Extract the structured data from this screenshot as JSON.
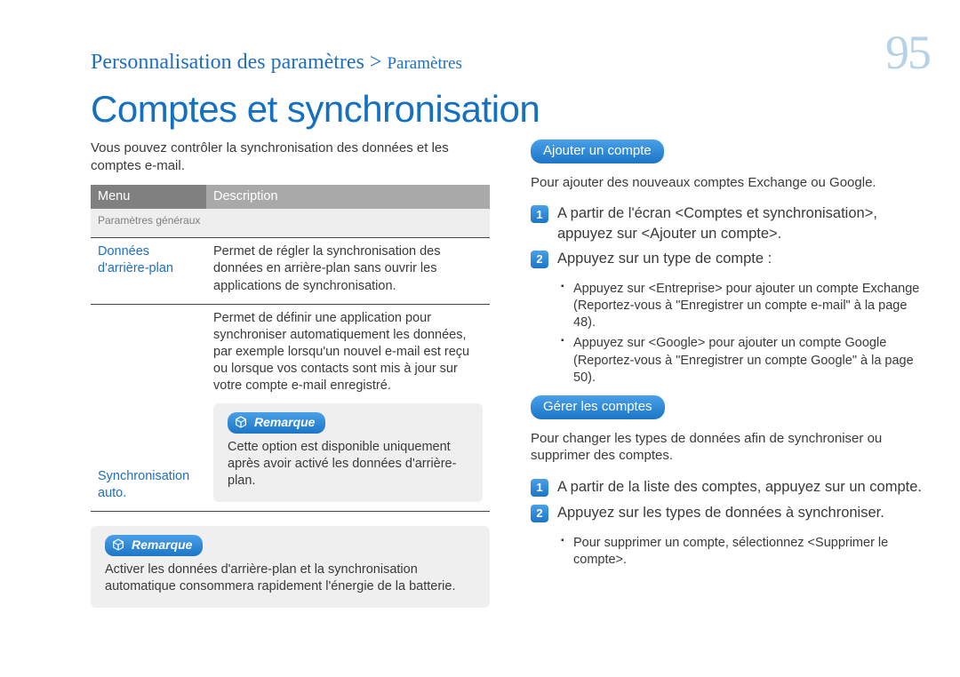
{
  "breadcrumb": {
    "main": "Personnalisation des paramètres",
    "sep": ">",
    "sub": "Paramètres"
  },
  "page_number": "95",
  "title": "Comptes et synchronisation",
  "left": {
    "intro": "Vous pouvez contrôler la synchronisation des données et les comptes e-mail.",
    "table": {
      "head_menu": "Menu",
      "head_desc": "Description",
      "subheader": "Paramètres généraux",
      "rows": [
        {
          "menu": "Données d'arrière-plan",
          "desc": "Permet de régler la synchronisation des données en arrière-plan sans ouvrir les applications de synchronisation."
        },
        {
          "menu": "Synchronisation auto.",
          "desc": "Permet de définir une application pour synchroniser automatiquement les données, par exemple lorsqu'un nouvel e-mail est reçu ou lorsque vos contacts sont mis à jour sur votre compte e-mail enregistré."
        }
      ]
    },
    "note_label": "Remarque",
    "inner_note": "Cette option est disponible uniquement après avoir activé les données d'arrière-plan.",
    "outer_note": "Activer les données d'arrière-plan et la synchronisation automatique consommera rapidement l'énergie de la batterie."
  },
  "right": {
    "section1": {
      "pill": "Ajouter un compte",
      "intro": "Pour ajouter des nouveaux comptes Exchange ou Google.",
      "steps": [
        "A partir de l'écran <Comptes et synchronisation>, appuyez sur <Ajouter un compte>.",
        "Appuyez sur un type de compte :"
      ],
      "bullets": [
        "Appuyez sur <Entreprise> pour ajouter un compte Exchange (Reportez-vous à \"Enregistrer un compte e-mail\" à la page 48).",
        "Appuyez sur <Google> pour ajouter un compte Google (Reportez-vous à \"Enregistrer un compte Google\" à la page 50)."
      ]
    },
    "section2": {
      "pill": "Gérer les comptes",
      "intro": "Pour changer les types de données afin de synchroniser ou supprimer des comptes.",
      "steps": [
        "A partir de la liste des comptes, appuyez sur un compte.",
        "Appuyez sur les types de données à synchroniser."
      ],
      "bullets": [
        "Pour supprimer un compte, sélectionnez <Supprimer le compte>."
      ]
    }
  }
}
